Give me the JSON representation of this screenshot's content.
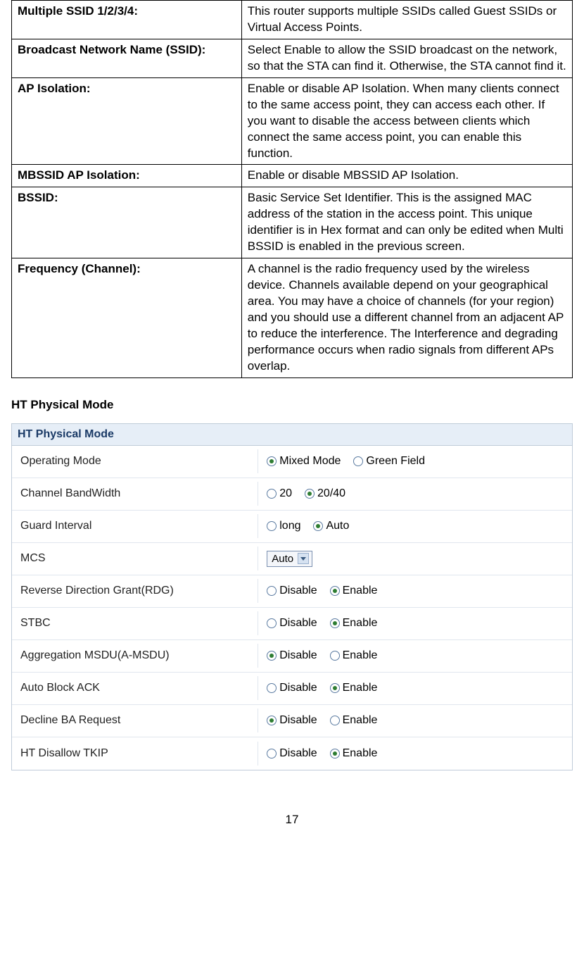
{
  "desc_table": [
    {
      "label": "Multiple SSID 1/2/3/4:",
      "text": "This router supports multiple SSIDs called Guest SSIDs or Virtual Access Points."
    },
    {
      "label": "Broadcast Network Name (SSID):",
      "text": "Select Enable to allow the SSID broadcast on the network, so that the STA can find it. Otherwise, the STA cannot find it."
    },
    {
      "label": "AP Isolation:",
      "text": "Enable or disable AP Isolation. When many clients connect to the same access point, they can access each other. If you want to disable the access between clients which connect the same access point, you can enable this function."
    },
    {
      "label": "MBSSID AP Isolation:",
      "text": "Enable or disable MBSSID AP Isolation."
    },
    {
      "label": "BSSID:",
      "text": "Basic Service Set Identifier. This is the assigned MAC address of the station in the access point. This unique identifier is in Hex format and can only be edited when Multi BSSID is enabled in the previous screen."
    },
    {
      "label": "Frequency (Channel):",
      "text": "A channel is the radio frequency used by the wireless device. Channels available depend on your geographical area. You may have a choice of channels (for your region) and you should use a different channel from an adjacent AP to reduce the interference. The Interference and degrading performance occurs when radio signals from different APs overlap."
    }
  ],
  "section_heading": "HT Physical Mode",
  "panel": {
    "title": "HT Physical Mode",
    "rows": [
      {
        "label": "Operating Mode",
        "type": "radio",
        "options": [
          {
            "text": "Mixed Mode",
            "selected": true
          },
          {
            "text": "Green Field",
            "selected": false
          }
        ]
      },
      {
        "label": "Channel BandWidth",
        "type": "radio",
        "options": [
          {
            "text": "20",
            "selected": false
          },
          {
            "text": "20/40",
            "selected": true
          }
        ]
      },
      {
        "label": "Guard Interval",
        "type": "radio",
        "options": [
          {
            "text": "long",
            "selected": false
          },
          {
            "text": "Auto",
            "selected": true
          }
        ]
      },
      {
        "label": "MCS",
        "type": "select",
        "value": "Auto"
      },
      {
        "label": "Reverse Direction Grant(RDG)",
        "type": "radio",
        "options": [
          {
            "text": "Disable",
            "selected": false
          },
          {
            "text": "Enable",
            "selected": true
          }
        ]
      },
      {
        "label": "STBC",
        "type": "radio",
        "options": [
          {
            "text": "Disable",
            "selected": false
          },
          {
            "text": "Enable",
            "selected": true
          }
        ]
      },
      {
        "label": "Aggregation MSDU(A-MSDU)",
        "type": "radio",
        "options": [
          {
            "text": "Disable",
            "selected": true
          },
          {
            "text": "Enable",
            "selected": false
          }
        ]
      },
      {
        "label": "Auto Block ACK",
        "type": "radio",
        "options": [
          {
            "text": "Disable",
            "selected": false
          },
          {
            "text": "Enable",
            "selected": true
          }
        ]
      },
      {
        "label": "Decline BA Request",
        "type": "radio",
        "options": [
          {
            "text": "Disable",
            "selected": true
          },
          {
            "text": "Enable",
            "selected": false
          }
        ]
      },
      {
        "label": "HT Disallow TKIP",
        "type": "radio",
        "options": [
          {
            "text": "Disable",
            "selected": false
          },
          {
            "text": "Enable",
            "selected": true
          }
        ]
      }
    ]
  },
  "page_number": "17"
}
